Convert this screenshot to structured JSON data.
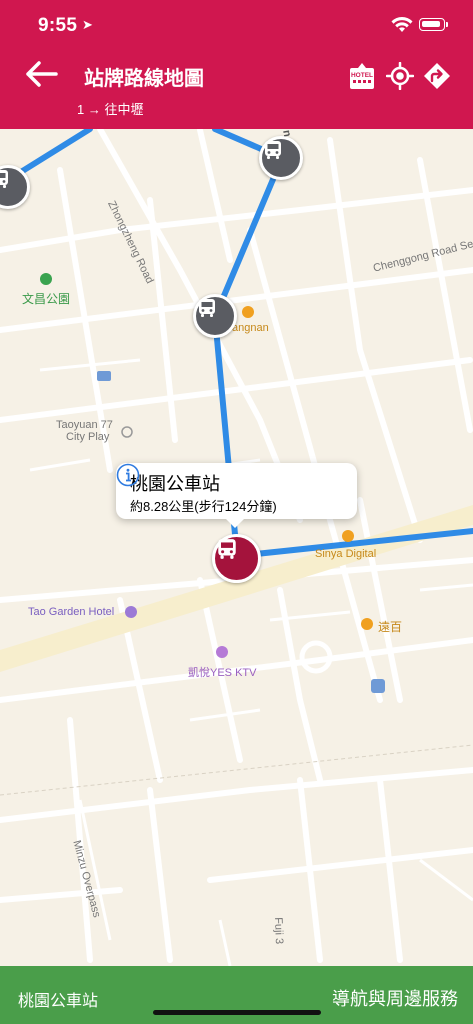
{
  "status_bar": {
    "time": "9:55"
  },
  "header": {
    "title": "站牌路線地圖",
    "subtitle": "1 → 往中壢",
    "hotel_icon_text": "HOTEL"
  },
  "map": {
    "labels": {
      "zhongzheng_road": "Zhongzheng Road",
      "road_fragment": "n Road",
      "chenggong_road": "Chenggong Road Section",
      "wenchang_park": "文昌公園",
      "gangnan": "angnan",
      "taoyuan77": "Taoyuan 77",
      "city_play": "City Play",
      "sinya": "Sinya Digital",
      "tao_garden": "Tao Garden Hotel",
      "yuanbai": "遠百",
      "ktv": "凱悅YES KTV",
      "minzu_overpass": "Minzu Overpass",
      "fuji": "Fuji 3"
    }
  },
  "callout": {
    "title": "桃園公車站",
    "subtitle": "約8.28公里(步行124分鐘)"
  },
  "footer": {
    "stop_name": "桃園公車站",
    "nav_label": "導航與周邊服務"
  },
  "colors": {
    "header": "#d0174f",
    "route": "#2f8be6",
    "selected_stop": "#a4133c",
    "stop": "#5a5c62",
    "footer": "#4a9e4a"
  }
}
